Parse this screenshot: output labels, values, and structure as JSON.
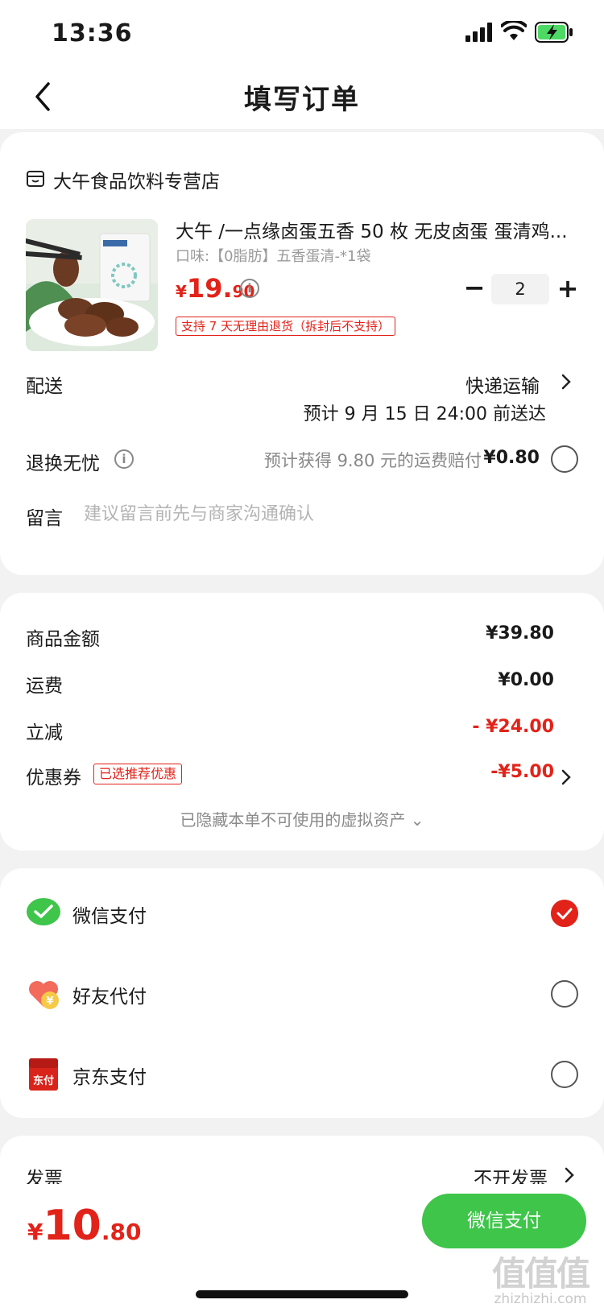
{
  "status_bar": {
    "time": "13:36"
  },
  "nav": {
    "title": "填写订单",
    "back_icon": "chevron-left-icon"
  },
  "store": {
    "name": "大午食品饮料专营店",
    "icon": "store-icon"
  },
  "product": {
    "title": "大午 /一点缘卤蛋五香 50 枚 无皮卤蛋 蛋清鸡...",
    "spec": "口味:【0脂肪】五香蛋清-*1袋",
    "price_currency": "¥",
    "price_int": "19.",
    "price_dec": "90",
    "quantity": "2",
    "minus_label": "−",
    "plus_label": "+",
    "return_tag": "支持 7 天无理由退货（拆封后不支持）"
  },
  "shipping": {
    "label": "配送",
    "method": "快递运输",
    "eta": "预计 9 月 15 日 24:00 前送达"
  },
  "return_insurance": {
    "label": "退换无忧",
    "desc": "预计获得 9.80 元的运费赔付",
    "amount": "¥0.80"
  },
  "message": {
    "label": "留言",
    "placeholder": "建议留言前先与商家沟通确认"
  },
  "fees": {
    "goods": {
      "label": "商品金额",
      "value": "¥39.80"
    },
    "shipping": {
      "label": "运费",
      "value": "¥0.00"
    },
    "discount": {
      "label": "立减",
      "value": "- ¥24.00"
    },
    "coupon": {
      "label": "优惠券",
      "tag": "已选推荐优惠",
      "value": "-¥5.00"
    },
    "hidden_note": "已隐藏本单不可使用的虚拟资产 ⌄"
  },
  "payments": [
    {
      "label": "微信支付",
      "icon": "wechat-pay-icon",
      "selected": true
    },
    {
      "label": "好友代付",
      "icon": "friend-pay-icon",
      "selected": false
    },
    {
      "label": "京东支付",
      "icon": "jd-pay-icon",
      "selected": false,
      "icon_text": "东付"
    }
  ],
  "invoice": {
    "label": "发票",
    "value": "不开发票"
  },
  "footer": {
    "total_currency": "¥",
    "total_int": "10",
    "total_dec": ".80",
    "pay_button": "微信支付"
  },
  "watermark": {
    "big": "值值值",
    "small": "zhizhizhi.com"
  },
  "colors": {
    "accent_red": "#e2231a",
    "wechat_green": "#3ec54a"
  }
}
